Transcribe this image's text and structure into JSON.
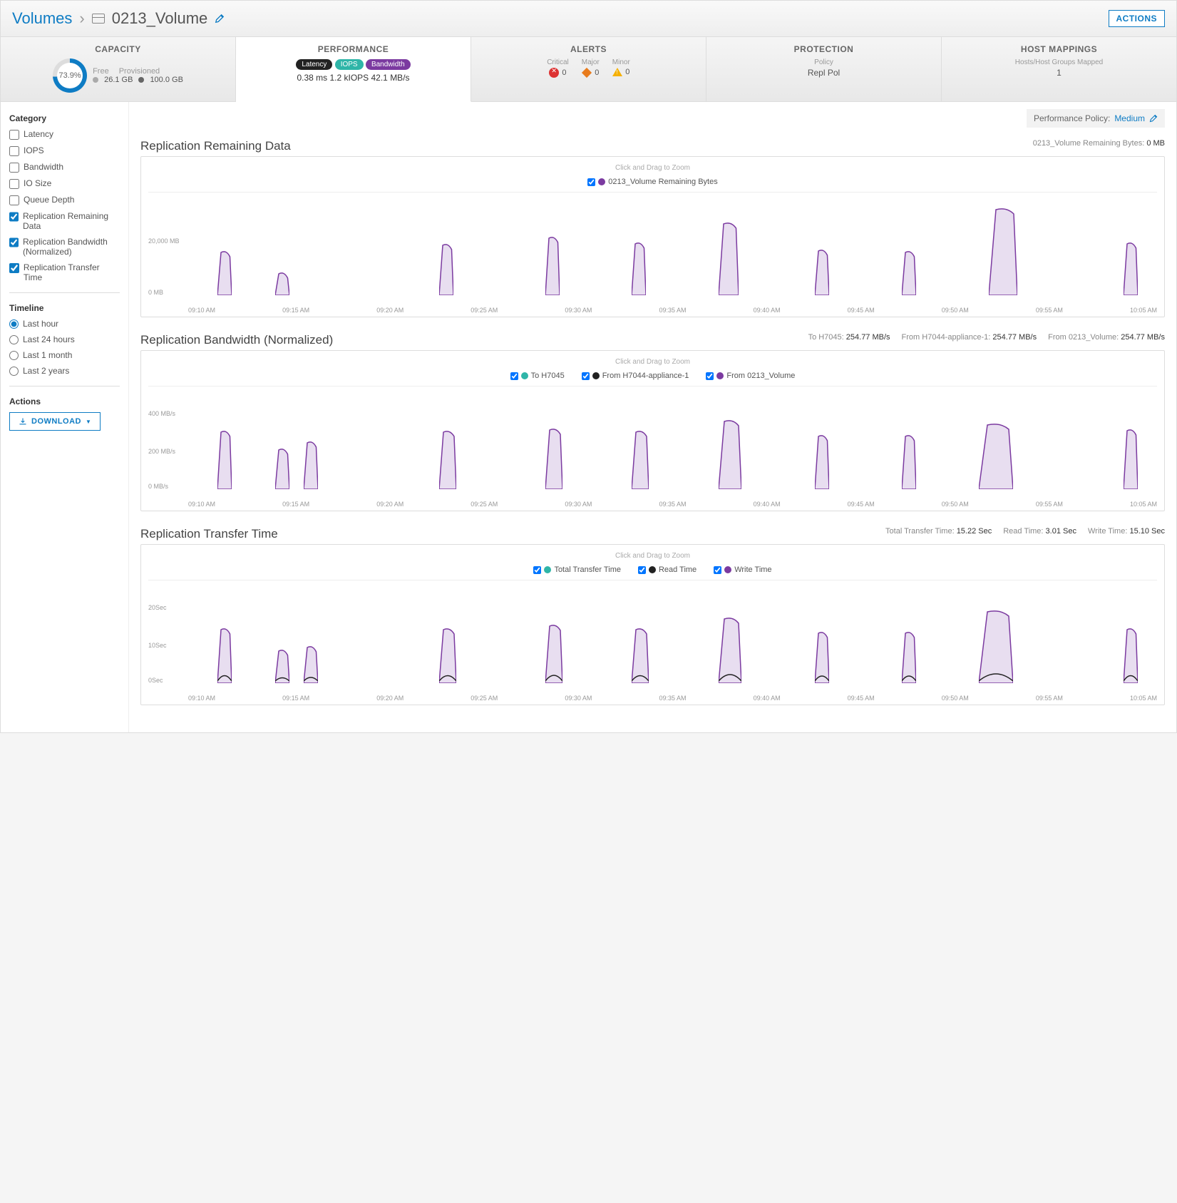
{
  "breadcrumb": {
    "root": "Volumes",
    "name": "0213_Volume"
  },
  "actions_button": "ACTIONS",
  "tabs": {
    "capacity": {
      "title": "CAPACITY",
      "pct": "73.9%",
      "free_label": "Free",
      "free": "26.1 GB",
      "prov_label": "Provisioned",
      "prov": "100.0 GB"
    },
    "performance": {
      "title": "PERFORMANCE",
      "pills": {
        "latency": "Latency",
        "iops": "IOPS",
        "bw": "Bandwidth"
      },
      "values": "0.38 ms 1.2 kIOPS 42.1 MB/s"
    },
    "alerts": {
      "title": "ALERTS",
      "critical": {
        "label": "Critical",
        "value": "0"
      },
      "major": {
        "label": "Major",
        "value": "0"
      },
      "minor": {
        "label": "Minor",
        "value": "0"
      }
    },
    "protection": {
      "title": "PROTECTION",
      "policy_label": "Policy",
      "policy": "Repl Pol"
    },
    "hosts": {
      "title": "HOST MAPPINGS",
      "label": "Hosts/Host Groups Mapped",
      "value": "1"
    }
  },
  "policy_bar": {
    "label": "Performance Policy:",
    "value": "Medium"
  },
  "sidebar": {
    "category_label": "Category",
    "categories": [
      {
        "label": "Latency",
        "checked": false
      },
      {
        "label": "IOPS",
        "checked": false
      },
      {
        "label": "Bandwidth",
        "checked": false
      },
      {
        "label": "IO Size",
        "checked": false
      },
      {
        "label": "Queue Depth",
        "checked": false
      },
      {
        "label": "Replication Remaining Data",
        "checked": true
      },
      {
        "label": "Replication Bandwidth (Normalized)",
        "checked": true
      },
      {
        "label": "Replication Transfer Time",
        "checked": true
      }
    ],
    "timeline_label": "Timeline",
    "timeline": [
      {
        "label": "Last hour",
        "checked": true
      },
      {
        "label": "Last 24 hours",
        "checked": false
      },
      {
        "label": "Last 1 month",
        "checked": false
      },
      {
        "label": "Last 2 years",
        "checked": false
      }
    ],
    "actions_label": "Actions",
    "download": "DOWNLOAD"
  },
  "zoom_hint": "Click and Drag to Zoom",
  "chart1": {
    "title": "Replication Remaining Data",
    "meta_label": "0213_Volume Remaining Bytes:",
    "meta_value": "0 MB",
    "legend": [
      {
        "label": "0213_Volume Remaining Bytes",
        "color": "purple"
      }
    ],
    "yticks": [
      "20,000 MB",
      "0 MB"
    ]
  },
  "chart2": {
    "title": "Replication Bandwidth (Normalized)",
    "meta": [
      {
        "k": "To H7045:",
        "v": "254.77 MB/s"
      },
      {
        "k": "From H7044-appliance-1:",
        "v": "254.77 MB/s"
      },
      {
        "k": "From 0213_Volume:",
        "v": "254.77 MB/s"
      }
    ],
    "legend": [
      {
        "label": "To H7045",
        "color": "teal"
      },
      {
        "label": "From H7044-appliance-1",
        "color": "black"
      },
      {
        "label": "From 0213_Volume",
        "color": "purple"
      }
    ],
    "yticks": [
      "400 MB/s",
      "200 MB/s",
      "0 MB/s"
    ]
  },
  "chart3": {
    "title": "Replication Transfer Time",
    "meta": [
      {
        "k": "Total Transfer Time:",
        "v": "15.22 Sec"
      },
      {
        "k": "Read Time:",
        "v": "3.01 Sec"
      },
      {
        "k": "Write Time:",
        "v": "15.10 Sec"
      }
    ],
    "legend": [
      {
        "label": "Total Transfer Time",
        "color": "teal"
      },
      {
        "label": "Read Time",
        "color": "black"
      },
      {
        "label": "Write Time",
        "color": "purple"
      }
    ],
    "yticks": [
      "20Sec",
      "10Sec",
      "0Sec"
    ]
  },
  "xticks": [
    "09:10 AM",
    "09:15 AM",
    "09:20 AM",
    "09:25 AM",
    "09:30 AM",
    "09:35 AM",
    "09:40 AM",
    "09:45 AM",
    "09:50 AM",
    "09:55 AM",
    "10:05 AM"
  ],
  "chart_data": [
    {
      "type": "area",
      "title": "Replication Remaining Data",
      "ylabel": "MB",
      "ylim": [
        0,
        25000
      ],
      "x": [
        "09:10",
        "09:11",
        "09:15",
        "09:16",
        "09:25",
        "09:26",
        "09:31",
        "09:32",
        "09:35",
        "09:36",
        "09:40",
        "09:41",
        "09:46",
        "09:47",
        "09:50",
        "09:51",
        "09:55",
        "09:57",
        "10:05",
        "10:06"
      ],
      "series": [
        {
          "name": "0213_Volume Remaining Bytes",
          "values": [
            15000,
            0,
            7000,
            0,
            17000,
            0,
            20000,
            0,
            18000,
            0,
            24000,
            0,
            16000,
            0,
            15000,
            0,
            28000,
            0,
            18000,
            0
          ]
        }
      ]
    },
    {
      "type": "area",
      "title": "Replication Bandwidth (Normalized)",
      "ylabel": "MB/s",
      "ylim": [
        0,
        450
      ],
      "x": [
        "09:10",
        "09:11",
        "09:15",
        "09:16",
        "09:17",
        "09:25",
        "09:26",
        "09:31",
        "09:32",
        "09:35",
        "09:36",
        "09:40",
        "09:41",
        "09:46",
        "09:47",
        "09:50",
        "09:51",
        "09:55",
        "09:57",
        "10:05",
        "10:06"
      ],
      "series": [
        {
          "name": "To H7045",
          "values": [
            330,
            0,
            260,
            0,
            280,
            330,
            0,
            340,
            0,
            330,
            0,
            380,
            0,
            310,
            0,
            310,
            0,
            360,
            360,
            340,
            0
          ]
        },
        {
          "name": "From H7044-appliance-1",
          "values": [
            330,
            0,
            260,
            0,
            280,
            330,
            0,
            340,
            0,
            330,
            0,
            380,
            0,
            310,
            0,
            310,
            0,
            360,
            360,
            340,
            0
          ]
        },
        {
          "name": "From 0213_Volume",
          "values": [
            330,
            0,
            260,
            0,
            280,
            330,
            0,
            340,
            0,
            330,
            0,
            380,
            0,
            310,
            0,
            310,
            0,
            360,
            360,
            340,
            0
          ]
        }
      ]
    },
    {
      "type": "area",
      "title": "Replication Transfer Time",
      "ylabel": "Sec",
      "ylim": [
        0,
        22
      ],
      "x": [
        "09:10",
        "09:11",
        "09:15",
        "09:16",
        "09:17",
        "09:25",
        "09:26",
        "09:31",
        "09:32",
        "09:35",
        "09:36",
        "09:40",
        "09:41",
        "09:46",
        "09:47",
        "09:50",
        "09:51",
        "09:55",
        "09:57",
        "10:05",
        "10:06"
      ],
      "series": [
        {
          "name": "Total Transfer Time",
          "values": [
            15,
            0,
            9,
            0,
            10,
            15,
            0,
            16,
            0,
            15,
            0,
            18,
            0,
            14,
            0,
            14,
            0,
            20,
            19,
            15,
            0
          ]
        },
        {
          "name": "Read Time",
          "values": [
            3,
            0,
            2,
            0,
            2,
            3,
            0,
            3,
            0,
            3,
            0,
            4,
            0,
            3,
            0,
            3,
            0,
            5,
            4,
            3,
            0
          ]
        },
        {
          "name": "Write Time",
          "values": [
            15,
            0,
            9,
            0,
            10,
            15,
            0,
            16,
            0,
            15,
            0,
            18,
            0,
            14,
            0,
            14,
            0,
            20,
            19,
            15,
            0
          ]
        }
      ]
    }
  ]
}
